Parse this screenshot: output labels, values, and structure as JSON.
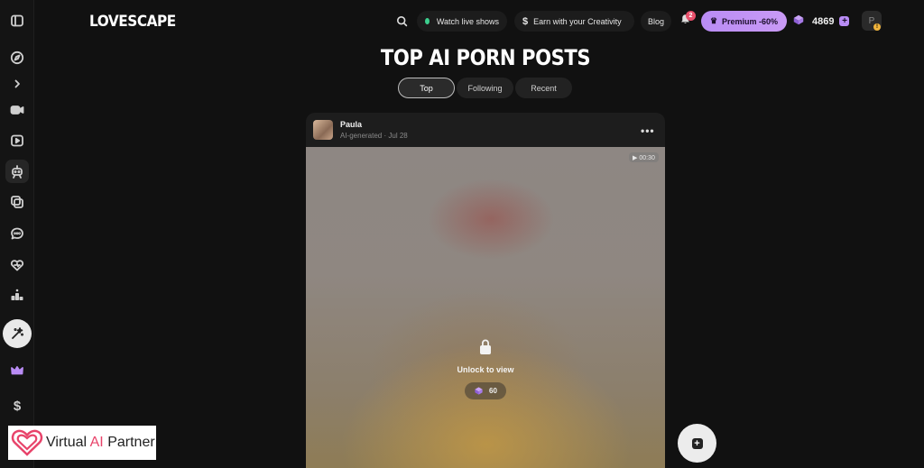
{
  "header": {
    "logo": "LOVESCAPE",
    "watch_live": "Watch live shows",
    "earn": "Earn with your Creativity",
    "earn_icon": "$",
    "blog": "Blog",
    "notification_count": "2",
    "premium": "Premium -60%",
    "coins": "4869",
    "coins_plus": "+",
    "avatar_initial": "P",
    "avatar_warning": "!"
  },
  "title": "TOP AI PORN POSTS",
  "tabs": [
    {
      "label": "Top",
      "active": true
    },
    {
      "label": "Following",
      "active": false
    },
    {
      "label": "Recent",
      "active": false
    }
  ],
  "post": {
    "author": "Paula",
    "meta": "AI-generated · Jul 28",
    "more": "•••",
    "duration": "▶ 00:30",
    "unlock_text": "Unlock to view",
    "price": "60"
  },
  "fab": {
    "label": "+"
  },
  "watermark": {
    "text_plain": "Virtual ",
    "text_accent": "AI",
    "text_end": " Partner"
  },
  "sidebar": {
    "items": [
      "sidebar-toggle",
      "explore",
      "expand",
      "video",
      "play",
      "ai-companion",
      "gallery",
      "chat",
      "heart",
      "leaderboard",
      "magic",
      "premium-crown",
      "earn-dollar"
    ],
    "dollar": "$"
  },
  "colors": {
    "accent": "#b98cf5",
    "live": "#3ccf8e",
    "badge": "#e8506b",
    "background": "#111111"
  }
}
